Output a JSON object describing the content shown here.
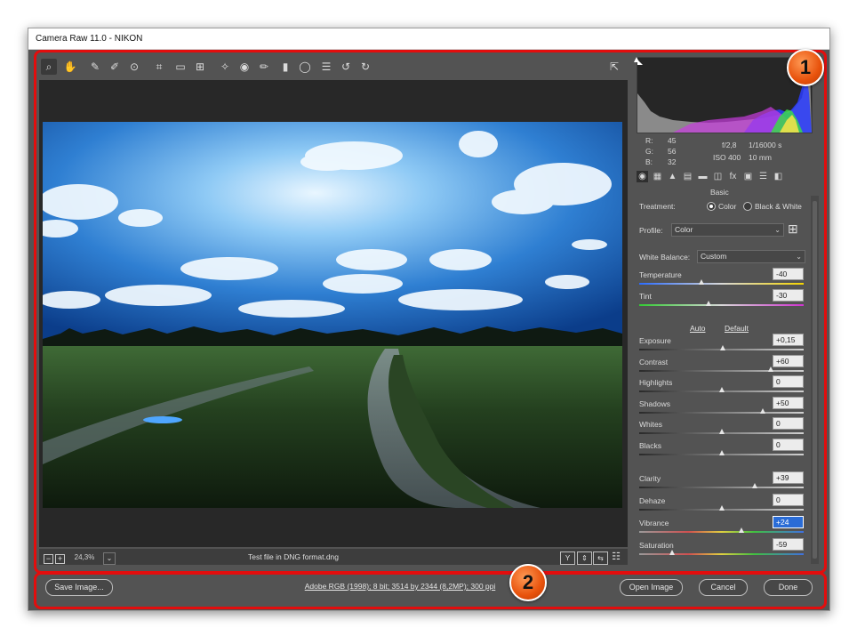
{
  "window": {
    "title": "Camera Raw 11.0  -  NIKON"
  },
  "annotations": {
    "badge1": "1",
    "badge2": "2"
  },
  "toolbar": {
    "tools": [
      {
        "name": "zoom-tool",
        "glyph": "⌕"
      },
      {
        "name": "hand-tool",
        "glyph": "✋"
      },
      {
        "name": "white-balance-tool",
        "glyph": "✎"
      },
      {
        "name": "color-sampler-tool",
        "glyph": "✐"
      },
      {
        "name": "targeted-adjustment-tool",
        "glyph": "⊙"
      },
      {
        "name": "crop-tool",
        "glyph": "⌗"
      },
      {
        "name": "straighten-tool",
        "glyph": "▭"
      },
      {
        "name": "transform-tool",
        "glyph": "⊞"
      },
      {
        "name": "spot-removal-tool",
        "glyph": "✧"
      },
      {
        "name": "red-eye-tool",
        "glyph": "◉"
      },
      {
        "name": "adjustment-brush-tool",
        "glyph": "✏"
      },
      {
        "name": "graduated-filter-tool",
        "glyph": "▮"
      },
      {
        "name": "radial-filter-tool",
        "glyph": "◯"
      },
      {
        "name": "preferences-tool",
        "glyph": "☰"
      },
      {
        "name": "rotate-left-tool",
        "glyph": "↺"
      },
      {
        "name": "rotate-right-tool",
        "glyph": "↻"
      }
    ],
    "fullscreen_glyph": "⇱"
  },
  "footer_bar": {
    "zoom_minus": "−",
    "zoom_plus": "+",
    "zoom_value": "24,3%",
    "zoom_dropdown": "⌄",
    "file_name": "Test file in DNG format.dng",
    "view_buttons": [
      "Y",
      "⇕",
      "⇆",
      "☷"
    ]
  },
  "readout": {
    "r_label": "R:",
    "r_value": "45",
    "g_label": "G:",
    "g_value": "56",
    "b_label": "B:",
    "b_value": "32",
    "aperture": "f/2,8",
    "shutter": "1/16000 s",
    "iso": "ISO 400",
    "focal": "10 mm"
  },
  "panel_tabs": [
    "◉",
    "▦",
    "▲",
    "▤",
    "▬",
    "◫",
    "fx",
    "▣",
    "☰",
    "◧"
  ],
  "basic": {
    "title": "Basic",
    "treatment_label": "Treatment:",
    "color_option": "Color",
    "bw_option": "Black & White",
    "profile_label": "Profile:",
    "profile_value": "Color",
    "profile_grid_icon": "⊞",
    "wb_label": "White Balance:",
    "wb_value": "Custom",
    "auto_link": "Auto",
    "default_link": "Default",
    "sliders": [
      {
        "label": "Temperature",
        "value": "-40",
        "pos": 0.38,
        "track": "temp"
      },
      {
        "label": "Tint",
        "value": "-30",
        "pos": 0.42,
        "track": "tint"
      },
      {
        "label": "Exposure",
        "value": "+0,15",
        "pos": 0.51,
        "track": "plain"
      },
      {
        "label": "Contrast",
        "value": "+60",
        "pos": 0.8,
        "track": "plain"
      },
      {
        "label": "Highlights",
        "value": "0",
        "pos": 0.5,
        "track": "plain"
      },
      {
        "label": "Shadows",
        "value": "+50",
        "pos": 0.75,
        "track": "plain"
      },
      {
        "label": "Whites",
        "value": "0",
        "pos": 0.5,
        "track": "plain"
      },
      {
        "label": "Blacks",
        "value": "0",
        "pos": 0.5,
        "track": "plain"
      },
      {
        "label": "Clarity",
        "value": "+39",
        "pos": 0.7,
        "track": "plain"
      },
      {
        "label": "Dehaze",
        "value": "0",
        "pos": 0.5,
        "track": "plain"
      },
      {
        "label": "Vibrance",
        "value": "+24",
        "pos": 0.62,
        "track": "vib",
        "selected": true
      },
      {
        "label": "Saturation",
        "value": "-59",
        "pos": 0.2,
        "track": "sat"
      }
    ]
  },
  "bottom": {
    "save_label": "Save Image...",
    "workflow_text": "Adobe RGB (1998); 8 bit; 3514 by 2344 (8,2MP); 300 ppi",
    "open_label": "Open Image",
    "cancel_label": "Cancel",
    "done_label": "Done"
  }
}
